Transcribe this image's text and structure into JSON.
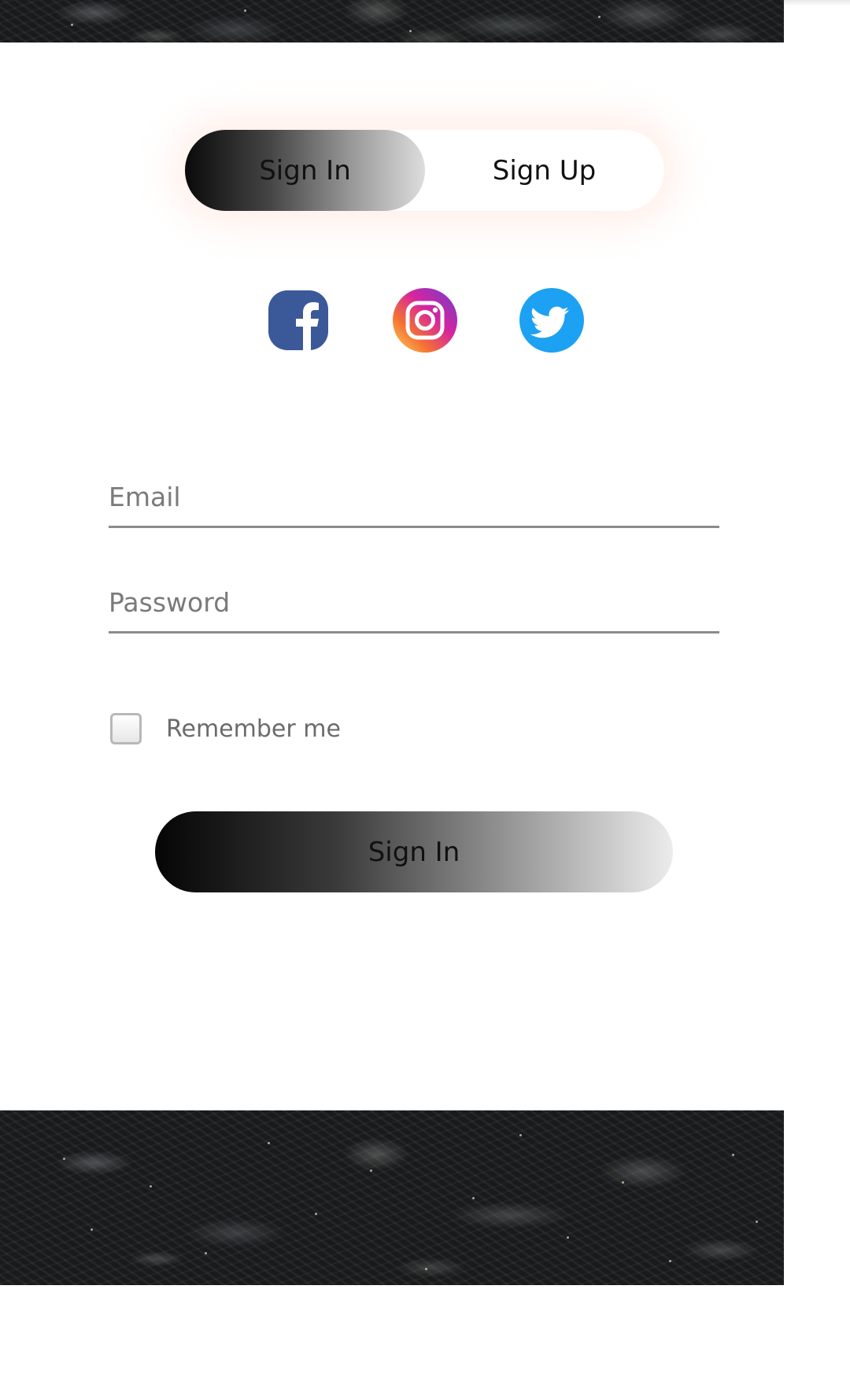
{
  "header_texture": {
    "alt": "dark water background"
  },
  "auth_toggle": {
    "signin_label": "Sign In",
    "signup_label": "Sign Up",
    "active": "Sign In"
  },
  "social": [
    {
      "name": "facebook-icon",
      "color": "#3b5998"
    },
    {
      "name": "instagram-icon",
      "color": "#d6249f"
    },
    {
      "name": "twitter-icon",
      "color": "#1da1f2"
    }
  ],
  "form": {
    "email": {
      "value": "",
      "placeholder": "Email"
    },
    "password": {
      "value": "",
      "placeholder": "Password"
    },
    "remember": {
      "label": "Remember me",
      "checked": false
    },
    "submit_label": "Sign In"
  },
  "colors": {
    "accent_gradient_start": "#000000",
    "accent_gradient_end": "#eeeeee",
    "field_underline": "#8c8c8c",
    "glow": "#ffd6c8"
  }
}
